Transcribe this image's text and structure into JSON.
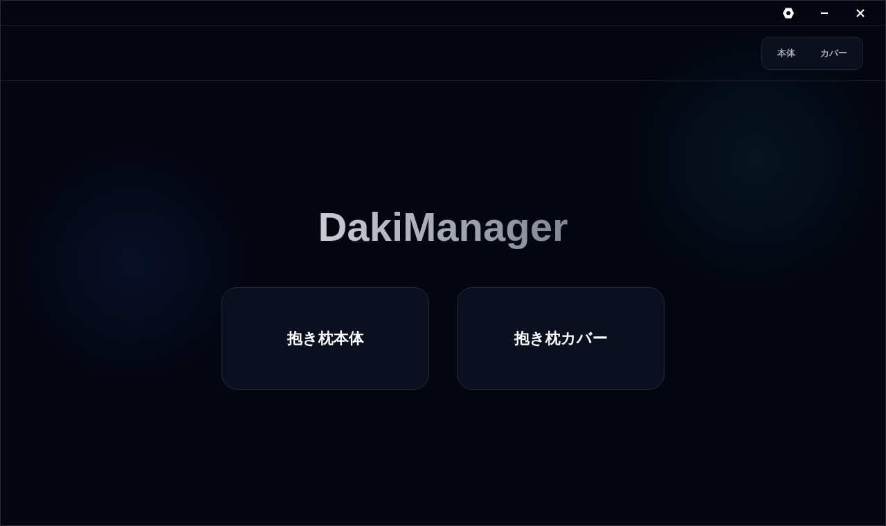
{
  "title_bar": {
    "buttons": [
      {
        "kind": "settings"
      },
      {
        "kind": "minimize"
      },
      {
        "kind": "close"
      }
    ]
  },
  "header": {
    "tabs": [
      {
        "label": "本体",
        "selected": false
      },
      {
        "label": "カバー",
        "selected": false
      }
    ]
  },
  "app_title": "DakiManager",
  "cards": [
    {
      "label": "抱き枕本体"
    },
    {
      "label": "抱き枕カバー"
    }
  ]
}
